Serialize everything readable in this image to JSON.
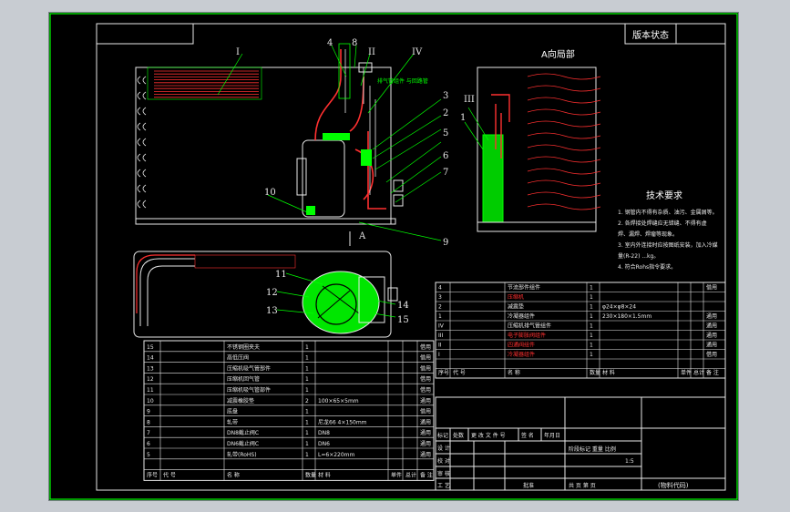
{
  "title_block": {
    "version_status": "版本状态",
    "direction_view": "A向局部",
    "view_marker": "A",
    "material_code": "(物料代码)",
    "total_sheets": "共 页 第 页",
    "stage_scale_header": "阶段标记  重量  比例",
    "scale": "1:5"
  },
  "technical_requirements": {
    "title": "技术要求",
    "lines": [
      "1. 钢管内不得有杂质、油污、金属屑等。",
      "2. 各焊接处焊缝应无错缝、不得有虚",
      "   焊、漏焊、焊瘤等现象。",
      "3. 室内外连接时应按图纸安装，加入冷媒",
      "   量(R-22) ...kg。",
      "4. 符合Rohs指令要求。"
    ]
  },
  "callouts": [
    "1",
    "2",
    "3",
    "4",
    "5",
    "6",
    "7",
    "8",
    "9",
    "10",
    "11",
    "12",
    "13",
    "14",
    "15",
    "I",
    "II",
    "III",
    "IV"
  ],
  "callout_note": "排气管组件\n与回路管",
  "bom_upper": {
    "rows": [
      {
        "no": "4",
        "name": "节流部件组件",
        "qty": "1",
        "material": "",
        "note": "借用",
        "red": false
      },
      {
        "no": "3",
        "name": "压缩机",
        "qty": "1",
        "material": "",
        "note": "",
        "red": true
      },
      {
        "no": "2",
        "name": "减震垫",
        "qty": "1",
        "material": "φ24×φ8×24",
        "note": "",
        "red": false
      },
      {
        "no": "1",
        "name": "冷凝器组件",
        "qty": "1",
        "material": "230×180×1.5mm",
        "note": "通用",
        "red": false
      },
      {
        "no": "IV",
        "name": "压缩机排气管组件",
        "qty": "1",
        "material": "",
        "note": "通用",
        "red": false
      },
      {
        "no": "III",
        "name": "电子膨胀阀组件",
        "qty": "1",
        "material": "",
        "note": "通用",
        "red": true
      },
      {
        "no": "II",
        "name": "四通阀组件",
        "qty": "1",
        "material": "",
        "note": "通用",
        "red": true
      },
      {
        "no": "I",
        "name": "冷凝器组件",
        "qty": "1",
        "material": "",
        "note": "借用",
        "red": true
      }
    ],
    "headers": {
      "no": "序号",
      "code": "代 号",
      "name": "名 称",
      "qty": "数量",
      "material": "材 料",
      "unit_w": "单件",
      "total_w": "总计",
      "weight": "重 量",
      "note": "备 注"
    }
  },
  "bom_lower": {
    "rows": [
      {
        "no": "15",
        "name": "不锈钢圈夹夫",
        "qty": "1",
        "material": "",
        "note": "借用"
      },
      {
        "no": "14",
        "name": "高低压阀",
        "qty": "1",
        "material": "",
        "note": "借用"
      },
      {
        "no": "13",
        "name": "压缩机吸气管部件",
        "qty": "1",
        "material": "",
        "note": "借用"
      },
      {
        "no": "12",
        "name": "压缩机回气管",
        "qty": "1",
        "material": "",
        "note": "借用"
      },
      {
        "no": "11",
        "name": "压缩机吸气管部件",
        "qty": "1",
        "material": "",
        "note": "借用"
      },
      {
        "no": "10",
        "name": "减震橡胶垫",
        "qty": "2",
        "material": "100×65×5mm",
        "note": "通用"
      },
      {
        "no": "9",
        "name": "底盘",
        "qty": "1",
        "material": "",
        "note": "借用"
      },
      {
        "no": "8",
        "name": "轧带",
        "qty": "1",
        "material": "尼龙66  4×150mm",
        "note": "通用"
      },
      {
        "no": "7",
        "name": "DN8截止阀C",
        "qty": "1",
        "material": "DN8",
        "note": "通用"
      },
      {
        "no": "6",
        "name": "DN6截止阀C",
        "qty": "1",
        "material": "DN6",
        "note": "通用"
      },
      {
        "no": "5",
        "name": "轧带(RoHS)",
        "qty": "1",
        "material": "L=6×220mm",
        "note": "通用"
      }
    ],
    "headers": {
      "no": "序号",
      "code": "代 号",
      "name": "名 称",
      "qty": "数量",
      "material": "材 料",
      "unit_w": "单件",
      "total_w": "总计",
      "weight": "重 量",
      "note": "备 注"
    }
  },
  "revision_block": {
    "row1": [
      "标记",
      "处数",
      "更 改 文 件 号",
      "签 名",
      "年月日"
    ],
    "roles": [
      "设 计",
      "校 对",
      "审 核",
      "工 艺"
    ],
    "approve": "批准"
  },
  "colors": {
    "green": "#00ff00",
    "red": "#ff2020",
    "white": "#e8e8e8",
    "yellow": "#ffff00",
    "cyan": "#00ffff",
    "magenta": "#ff40ff"
  }
}
